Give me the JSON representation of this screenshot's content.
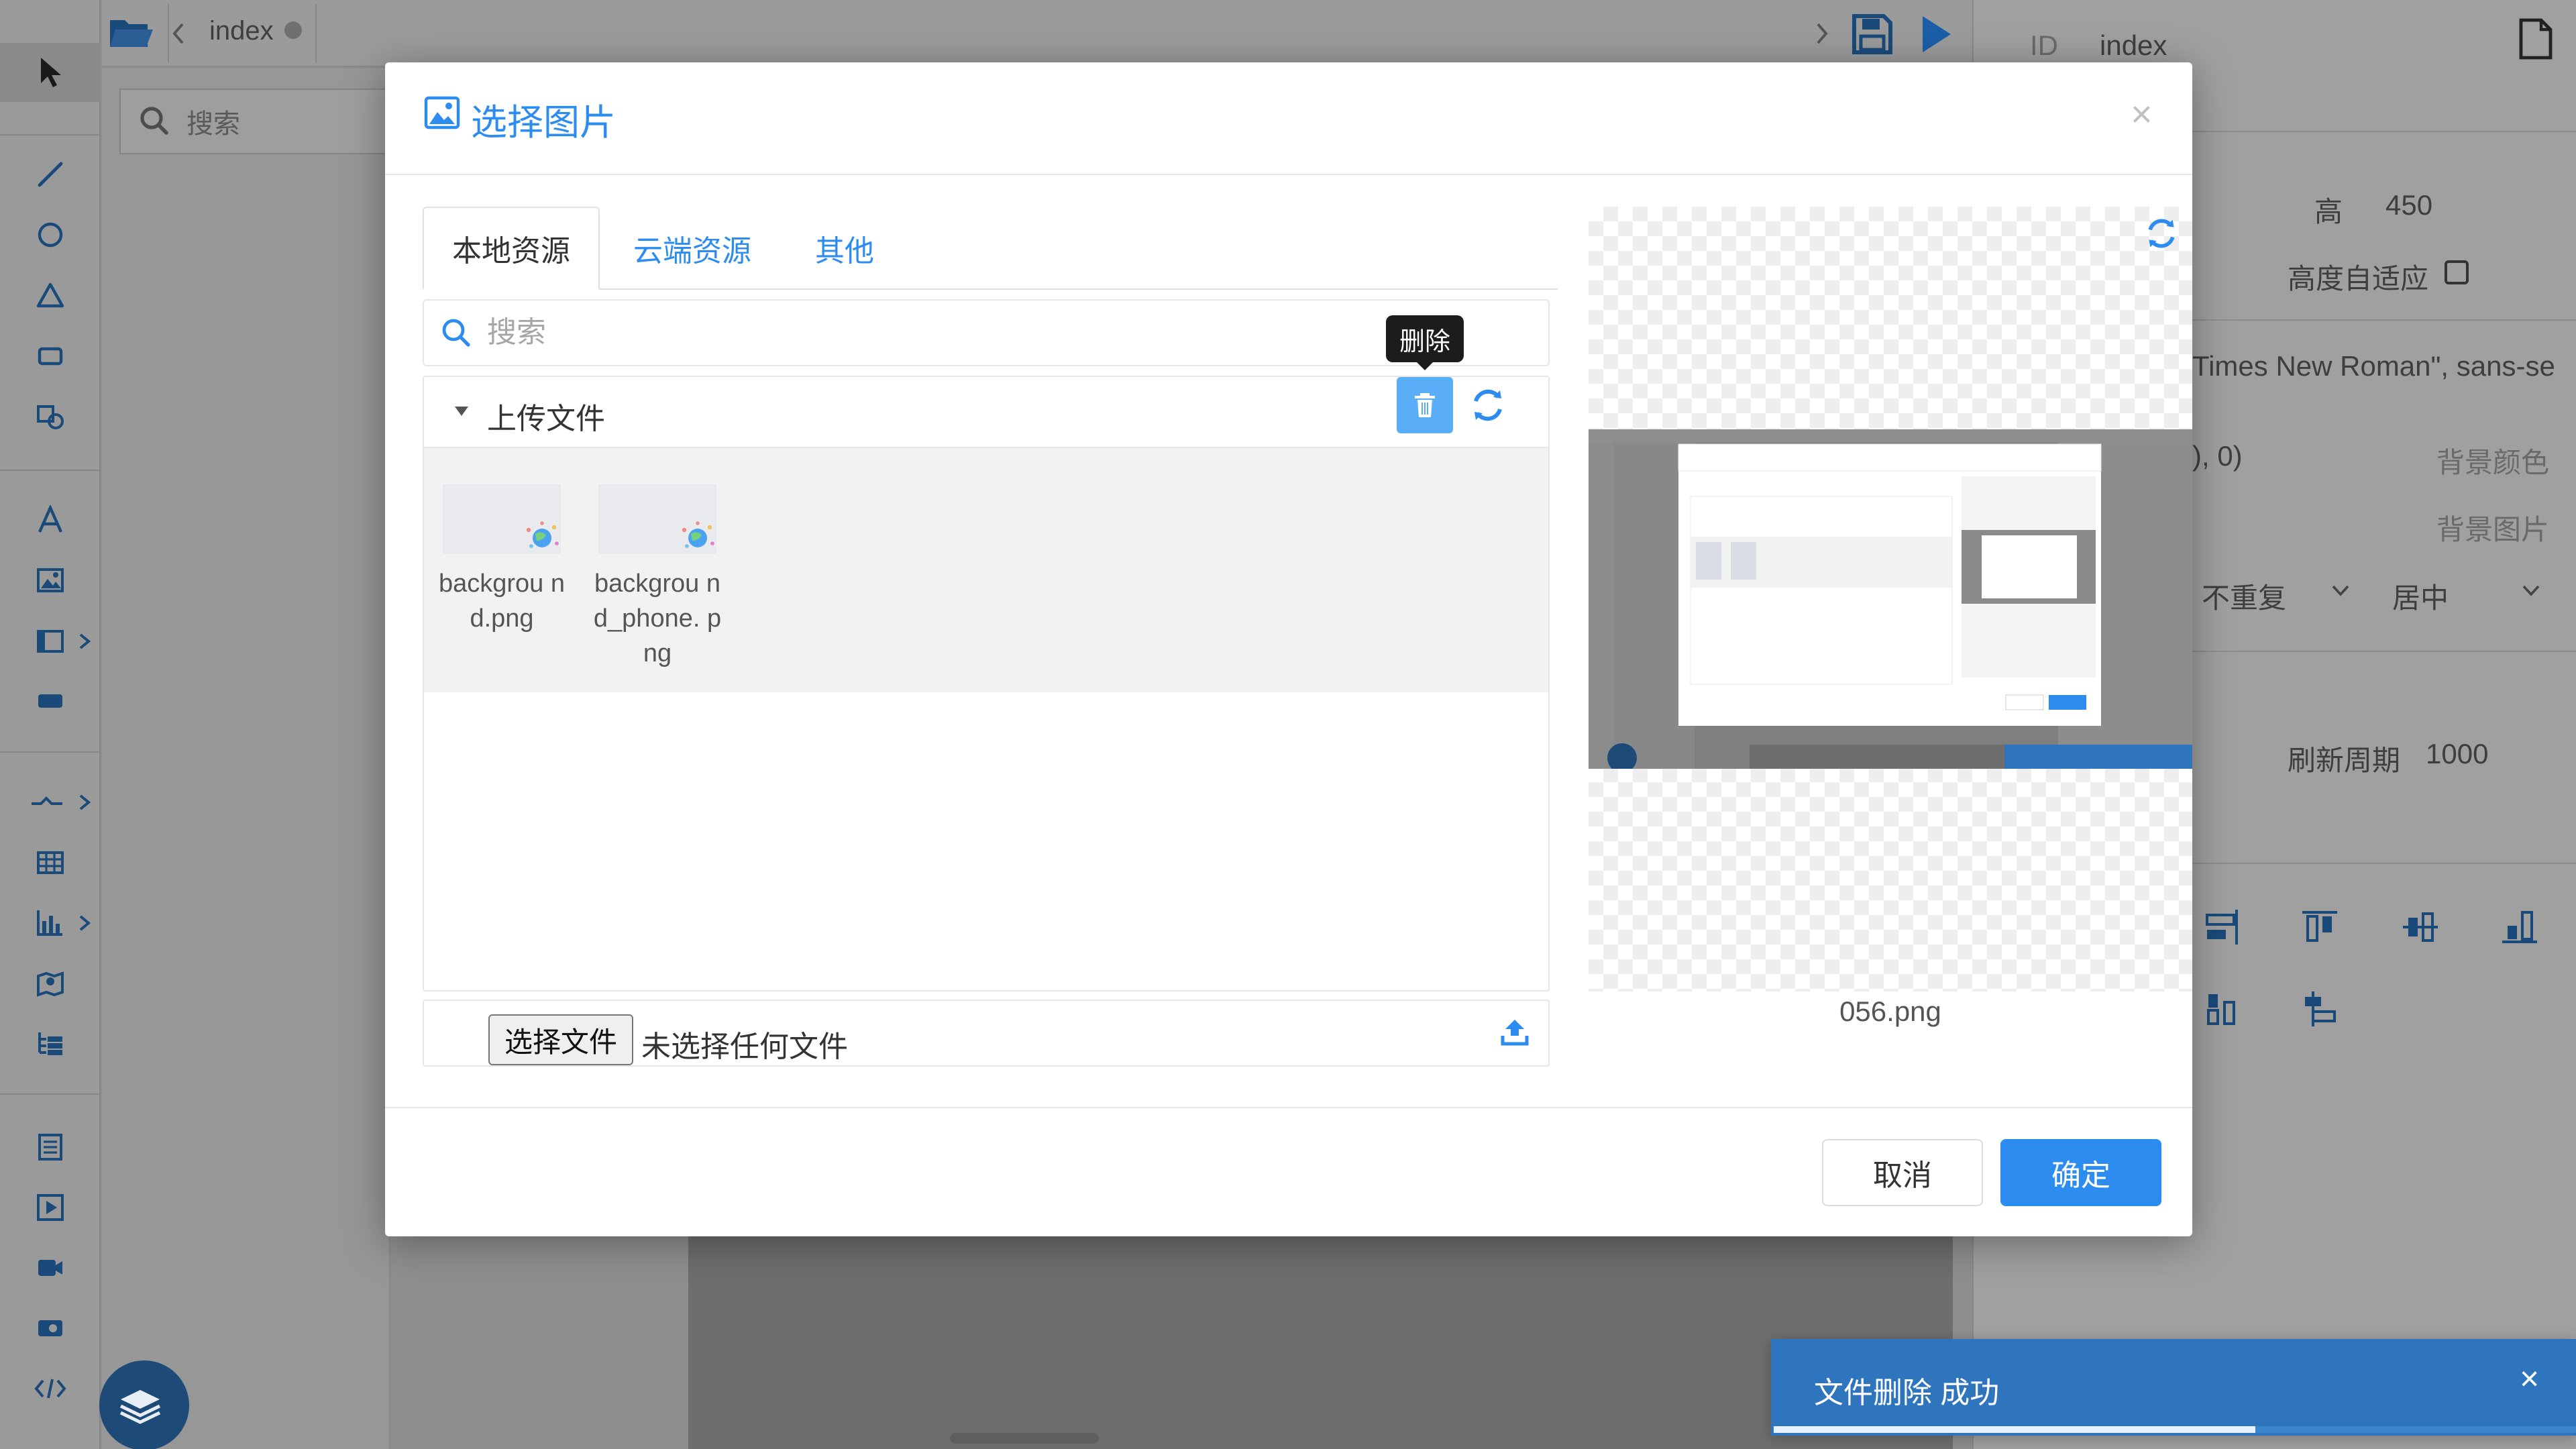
{
  "app": {
    "tab_label": "index",
    "left_search_placeholder": "搜索"
  },
  "properties": {
    "id_label": "ID",
    "id_value": "index",
    "height_label": "高",
    "height_value": "450",
    "auto_height_label": "高度自适应",
    "font_value": "Times New Roman\", sans-se",
    "color_fragment": "), 0)",
    "bg_color_label": "背景颜色",
    "bg_image_label": "背景图片",
    "repeat_value": "不重复",
    "position_value": "居中",
    "refresh_label": "刷新周期",
    "refresh_value": "1000"
  },
  "dialog": {
    "title": "选择图片",
    "close": "×",
    "tabs": [
      {
        "label": "本地资源",
        "active": true
      },
      {
        "label": "云端资源",
        "active": false
      },
      {
        "label": "其他",
        "active": false
      }
    ],
    "search_placeholder": "搜索",
    "group_title": "上传文件",
    "delete_tooltip": "删除",
    "files": [
      {
        "name": "backgrou nd.png"
      },
      {
        "name": "backgrou nd_phone. png"
      }
    ],
    "choose_file_label": "选择文件",
    "no_file_label": "未选择任何文件",
    "preview_filename": "056.png",
    "cancel_label": "取消",
    "ok_label": "确定"
  },
  "toast": {
    "message": "文件删除 成功",
    "close": "×",
    "progress": 0.6
  },
  "colors": {
    "accent": "#2d8cf0",
    "delete_button": "#5aaef8",
    "toast_bg": "#2e75be",
    "toolbar_icon": "#1a4a7a"
  },
  "icons": [
    "select-pointer-icon",
    "line-tool-icon",
    "circle-tool-icon",
    "triangle-tool-icon",
    "rectangle-tool-icon",
    "shape-edit-icon",
    "text-tool-icon",
    "image-tool-icon",
    "panel-tool-icon",
    "button-tool-icon",
    "connector-tool-icon",
    "table-tool-icon",
    "chart-tool-icon",
    "map-tool-icon",
    "tree-tool-icon",
    "list-tool-icon",
    "video-play-icon",
    "camera-icon",
    "record-icon",
    "code-icon",
    "folder-icon",
    "save-icon",
    "play-icon",
    "search-icon",
    "image-icon",
    "trash-icon",
    "refresh-icon",
    "caret-down-icon",
    "upload-icon",
    "layers-icon",
    "file-icon",
    "close-icon"
  ]
}
